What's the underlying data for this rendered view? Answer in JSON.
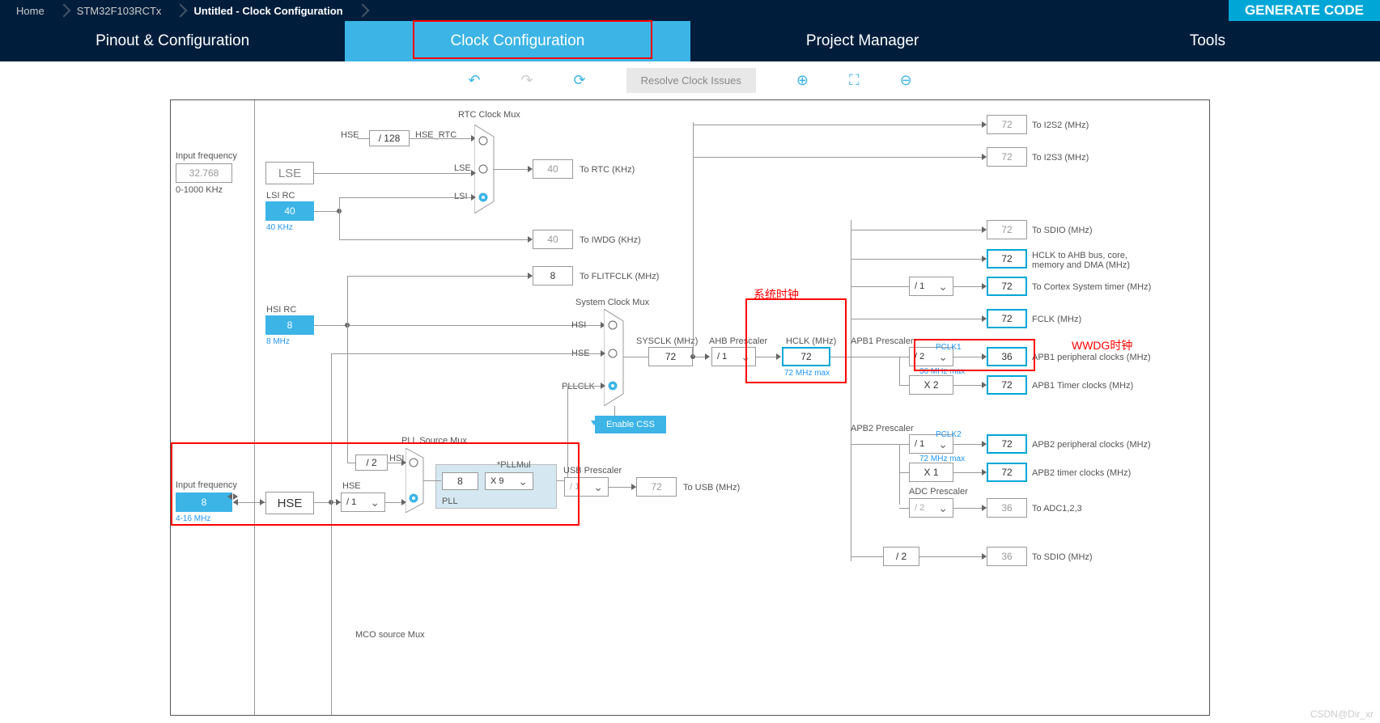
{
  "crumbs": [
    "Home",
    "STM32F103RCTx",
    "Untitled - Clock Configuration"
  ],
  "generate": "GENERATE CODE",
  "tabs": [
    "Pinout & Configuration",
    "Clock Configuration",
    "Project Manager",
    "Tools"
  ],
  "toolbar": {
    "resolve": "Resolve Clock Issues"
  },
  "input_freq_label": "Input frequency",
  "lse_freq": "32.768",
  "lse_range": "0-1000 KHz",
  "hse_freq": "8",
  "hse_range": "4-16 MHz",
  "lse_label": "LSE",
  "lsi_rc_label": "LSI RC",
  "lsi_val": "40",
  "lsi_freq": "40 KHz",
  "hsi_rc_label": "HSI RC",
  "hsi_val": "8",
  "hsi_freq": "8 MHz",
  "hse_label": "HSE",
  "hse_div": "/ 1",
  "hse_rtc_div": "/ 128",
  "hse_rtc_lbl": "HSE_RTC",
  "hse_lbl": "HSE",
  "lse_lbl": "LSE",
  "lsi_lbl": "LSI",
  "rtc_mux": "RTC Clock Mux",
  "rtc_val": "40",
  "rtc_out": "To RTC (KHz)",
  "iwdg_val": "40",
  "iwdg_out": "To IWDG (KHz)",
  "flitf_val": "8",
  "flitf_out": "To FLITFCLK (MHz)",
  "sys_mux": "System Clock Mux",
  "hsi_lbl": "HSI",
  "pll_src_mux": "PLL Source Mux",
  "hsi_div2": "/ 2",
  "pll_in": "8",
  "pll_mul_lbl": "*PLLMul",
  "pll_mul": "X 9",
  "pll_lbl": "PLL",
  "hse_pllsrc": "HSE",
  "hsi_pllsrc": "HSI",
  "pllclk": "PLLCLK",
  "css": "Enable CSS",
  "sysclk_lbl": "SYSCLK (MHz)",
  "sysclk": "72",
  "ahb_pre_lbl": "AHB Prescaler",
  "ahb_pre": "/ 1",
  "hclk_lbl": "HCLK (MHz)",
  "hclk": "72",
  "hclk_max": "72 MHz max",
  "usb_pre_lbl": "USB Prescaler",
  "usb_pre": "/ 1",
  "usb_val": "72",
  "usb_out": "To USB (MHz)",
  "apb1_pre_lbl": "APB1 Prescaler",
  "apb1_pre": "/ 2",
  "apb1_x2": "X 2",
  "pclk1_lbl": "PCLK1",
  "pclk1_max": "36 MHz max",
  "pclk1": "36",
  "apb1_peri": "APB1 peripheral clocks (MHz)",
  "apb1_tim": "72",
  "apb1_tim_out": "APB1 Timer clocks (MHz)",
  "apb2_pre_lbl": "APB2 Prescaler",
  "apb2_pre": "/ 1",
  "apb2_x1": "X 1",
  "pclk2_lbl": "PCLK2",
  "pclk2_max": "72 MHz max",
  "pclk2": "72",
  "apb2_peri": "APB2 peripheral clocks (MHz)",
  "apb2_tim": "72",
  "apb2_tim_out": "APB2 timer clocks (MHz)",
  "adc_pre_lbl": "ADC Prescaler",
  "adc_pre": "/ 2",
  "adc_val": "36",
  "adc_out": "To ADC1,2,3",
  "sdio_div": "/ 2",
  "sdio_val2": "36",
  "sdio_out2": "To SDIO (MHz)",
  "i2s2_val": "72",
  "i2s2_out": "To I2S2 (MHz)",
  "i2s3_val": "72",
  "i2s3_out": "To I2S3 (MHz)",
  "sdio_val": "72",
  "sdio_out": "To SDIO (MHz)",
  "ahb_bus": "HCLK to AHB bus, core, memory and DMA (MHz)",
  "ahb_bus_val": "72",
  "cortex_div": "/ 1",
  "cortex_val": "72",
  "cortex_out": "To Cortex System timer (MHz)",
  "fclk_val": "72",
  "fclk_out": "FCLK (MHz)",
  "mco_mux": "MCO source Mux",
  "anno1": "系统时钟",
  "anno2": "WWDG时钟",
  "watermark": "CSDN@Dir_xr"
}
